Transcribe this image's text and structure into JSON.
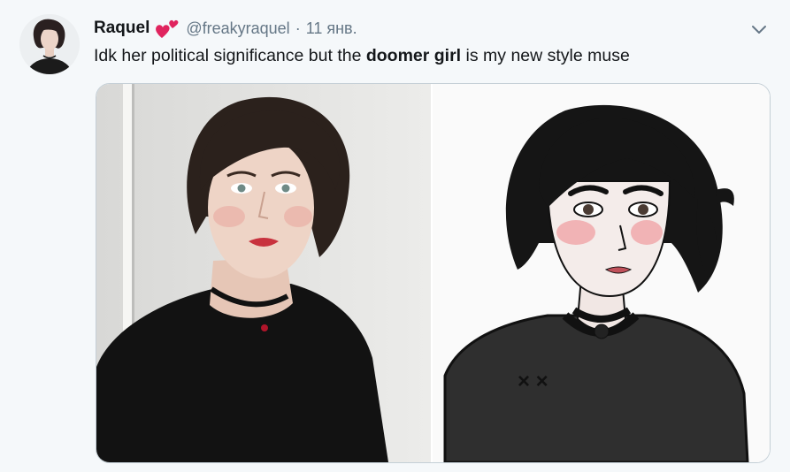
{
  "tweet": {
    "author_name": "Raquel",
    "handle": "@freakyraquel",
    "separator": "·",
    "date": "11 янв.",
    "text_before": "Idk her political significance but the ",
    "text_bold": "doomer girl",
    "text_after": " is my new style muse"
  },
  "icons": {
    "heart": "two-hearts-icon",
    "menu": "chevron-down-icon"
  },
  "colors": {
    "background": "#f5f8fa",
    "primary_text": "#14171a",
    "secondary_text": "#657786",
    "heart": "#e0245e"
  }
}
